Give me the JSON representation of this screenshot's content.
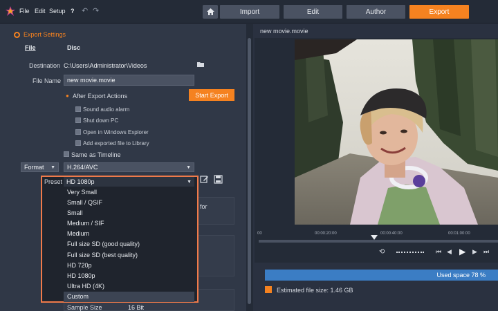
{
  "menu": {
    "file": "File",
    "edit": "Edit",
    "setup": "Setup",
    "help": "?"
  },
  "tabs": [
    {
      "label": "Import"
    },
    {
      "label": "Edit"
    },
    {
      "label": "Author"
    },
    {
      "label": "Export"
    }
  ],
  "export_settings": {
    "title": "Export Settings",
    "subtabs": [
      "File",
      "Disc"
    ],
    "destination_label": "Destination",
    "destination_value": "C:\\Users\\Administrator\\Videos",
    "filename_label": "File Name",
    "filename_value": "new movie.movie",
    "after_export_label": "After Export Actions",
    "start_export": "Start Export",
    "actions": [
      "Sound audio alarm",
      "Shut down PC",
      "Open in Windows Explorer",
      "Add exported file to Library"
    ],
    "same_as_timeline": "Same as Timeline",
    "format_label": "Format",
    "format_value": "H.264/AVC",
    "preset_label": "Preset",
    "preset_value": "HD 1080p",
    "preset_options": [
      "Very Small",
      "Small / QSIF",
      "Small",
      "Medium / SIF",
      "Medium",
      "Full size SD (good quality)",
      "Full size SD (best quality)",
      "HD 720p",
      "HD 1080p",
      "Ultra HD (4K)",
      "Custom"
    ],
    "hidden_for_text": "for",
    "sample_size_label": "Sample Size",
    "sample_size_value": "16 Bit"
  },
  "preview": {
    "title": "new movie.movie",
    "ticks": [
      "00",
      "00:00:20:00",
      "00:00:40:00",
      "00:01:00:00"
    ]
  },
  "status": {
    "used_space": "Used space 78 %",
    "used_space_fraction": 0.78,
    "estimated_size": "Estimated file size: 1.46 GB"
  },
  "colors": {
    "accent": "#f58220",
    "bar": "#3b7dc4",
    "highlight_border": "#f07a4a"
  }
}
